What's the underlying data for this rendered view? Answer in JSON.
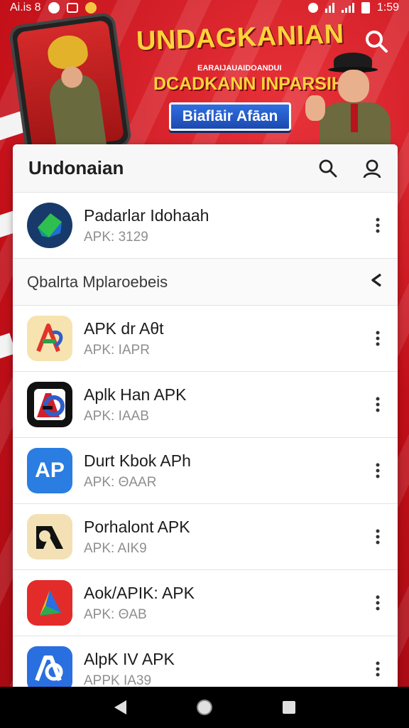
{
  "status_bar": {
    "left_text": "Ai.is 8",
    "time": "1:59"
  },
  "banner": {
    "title": "UNDAGKANIAN",
    "small_text": "EARAIJAUAIDOANDUI",
    "subtitle": "DCADKANN INPARSIH",
    "button_label": "Biaflāir Afāan"
  },
  "panel": {
    "title": "Undonaian",
    "top_app": {
      "name": "Padarlar Idohaah",
      "sub": "APK: 3129",
      "icon": "green-cube-icon"
    },
    "section": {
      "label": "Qbalrta Mplaroebeis"
    },
    "apps": [
      {
        "name": "APK dr Aθt",
        "sub": "APK: IAPR",
        "icon": "colorful-a-icon",
        "colors": [
          "#f6e3b0",
          "#e2332a",
          "#2d9e4a"
        ]
      },
      {
        "name": "Aplk Han APK",
        "sub": "APK: IAAB",
        "icon": "red-blue-a-icon",
        "colors": [
          "#111111",
          "#d1202a",
          "#2f5ec9"
        ]
      },
      {
        "name": "Durt Kbok APh",
        "sub": "APK: ΘAAR",
        "icon": "ap-blue-icon",
        "colors": [
          "#2a7de1",
          "#ffffff"
        ]
      },
      {
        "name": "Porhalont APK",
        "sub": "APK: AIK9",
        "icon": "black-a-icon",
        "colors": [
          "#f3e1b5",
          "#111111"
        ]
      },
      {
        "name": "Aok/APIK: APK",
        "sub": "APK: ΘAB",
        "icon": "triangle-play-icon",
        "colors": [
          "#e32c2a",
          "#2a6fe0",
          "#f7c21c",
          "#2fa84f"
        ]
      },
      {
        "name": "AlpK IV APK",
        "sub": "APPK IA39",
        "icon": "ab-blue-icon",
        "colors": [
          "#2a6fe0",
          "#ffffff"
        ]
      }
    ]
  }
}
